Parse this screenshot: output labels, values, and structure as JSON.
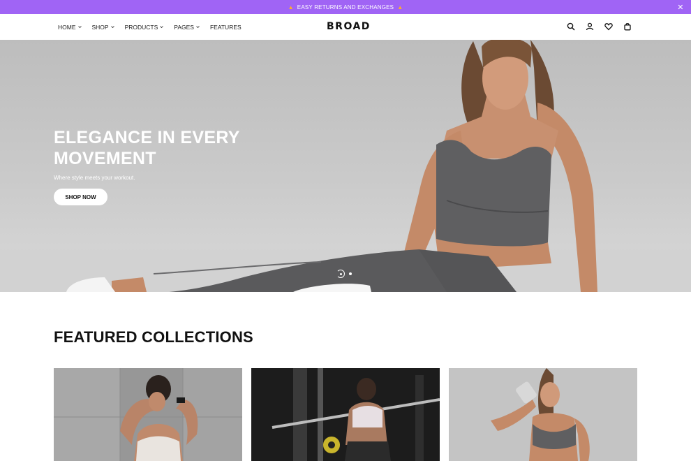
{
  "announcement": {
    "text": "EASY RETURNS AND EXCHANGES",
    "left_icon": "fire-icon",
    "right_icon": "fire-icon",
    "close_icon": "close-icon"
  },
  "nav": {
    "items": [
      {
        "label": "HOME",
        "has_dropdown": true
      },
      {
        "label": "SHOP",
        "has_dropdown": true
      },
      {
        "label": "PRODUCTS",
        "has_dropdown": true
      },
      {
        "label": "PAGES",
        "has_dropdown": true
      },
      {
        "label": "FEATURES",
        "has_dropdown": false
      }
    ]
  },
  "brand": {
    "logo_text": "BROAD"
  },
  "header_icons": [
    "search-icon",
    "account-icon",
    "wishlist-icon",
    "cart-icon"
  ],
  "hero": {
    "title": "ELEGANCE IN EVERY MOVEMENT",
    "subtitle": "Where style meets your workout.",
    "button_label": "SHOP NOW",
    "slides_total": 2,
    "active_slide": 1
  },
  "featured": {
    "title": "FEATURED COLLECTIONS",
    "cards": [
      {
        "image": "woman-stretching-against-wall"
      },
      {
        "image": "woman-lifting-barbell-in-gym"
      },
      {
        "image": "woman-drinking-from-shaker"
      }
    ]
  },
  "colors": {
    "announcement_bg": "#a064f5",
    "hero_bg": "#c6c6c6",
    "text_primary": "#111111"
  }
}
